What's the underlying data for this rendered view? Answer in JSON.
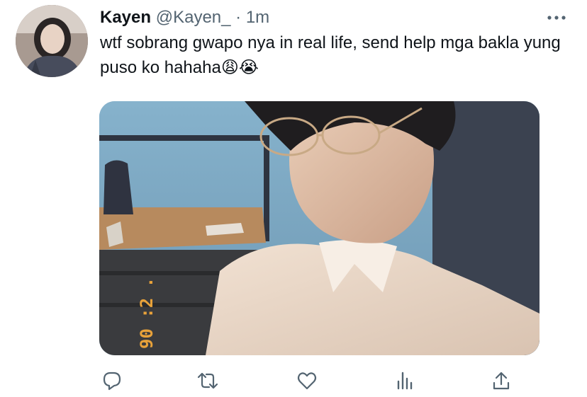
{
  "tweet": {
    "display_name": "Kayen",
    "handle": "@Kayen_",
    "separator": "·",
    "timestamp": "1m",
    "text": "wtf sobrang gwapo nya in real life, send help mga bakla yung puso ko hahaha",
    "emojis": "😩😭",
    "more_icon": "more-dots-icon"
  },
  "media": {
    "date_stamp": "90 :2 ."
  },
  "actions": [
    {
      "name": "reply-button",
      "icon": "reply-icon"
    },
    {
      "name": "retweet-button",
      "icon": "retweet-icon"
    },
    {
      "name": "like-button",
      "icon": "heart-icon"
    },
    {
      "name": "analytics-button",
      "icon": "analytics-icon"
    },
    {
      "name": "share-button",
      "icon": "share-icon"
    }
  ],
  "colors": {
    "text": "#0f1419",
    "muted": "#536471"
  }
}
